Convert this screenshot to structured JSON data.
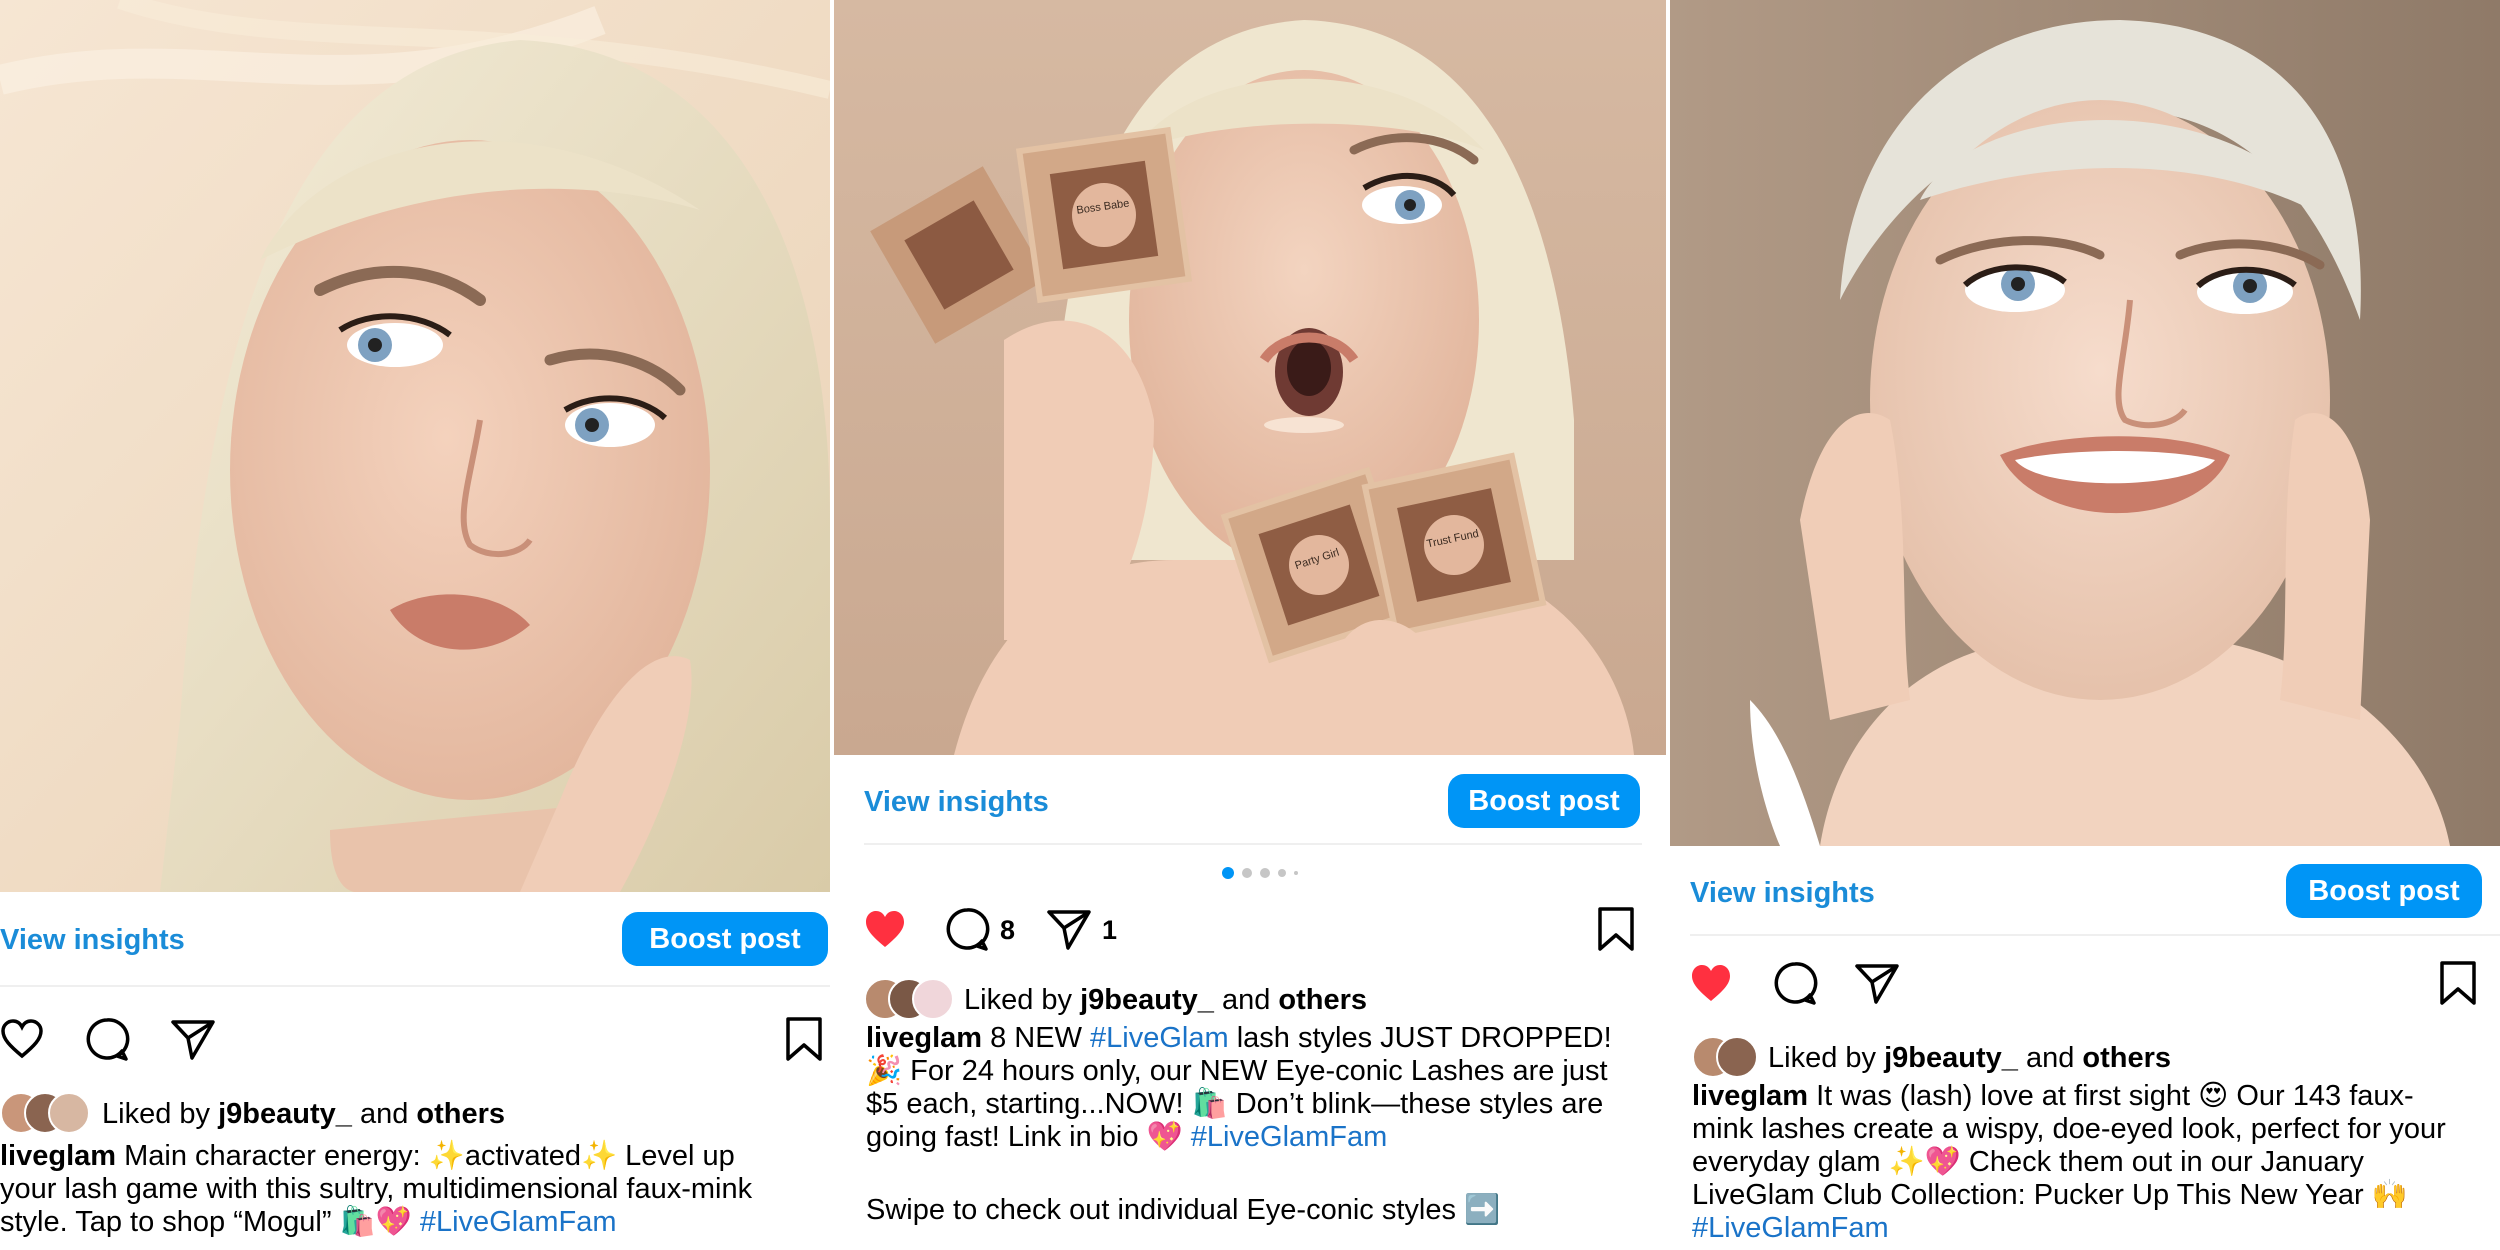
{
  "colors": {
    "accent": "#0095f6",
    "link": "#1a8cd8",
    "like_red": "#ff3040"
  },
  "posts": [
    {
      "view_insights": "View insights",
      "boost_post": "Boost post",
      "liked_prefix": "Liked by",
      "liked_user": "j9beauty_",
      "liked_and": "and",
      "liked_others": "others",
      "username": "liveglam",
      "caption_line1": "Main character energy: ✨activated✨ Level up",
      "caption_line2": "your lash game with this sultry, multidimensional faux-mink",
      "caption_line3": "style. Tap to shop “Mogul” 🛍️💖",
      "hashtag": "#LiveGlamFam",
      "liked": false
    },
    {
      "view_insights": "View insights",
      "boost_post": "Boost post",
      "comment_count": "8",
      "share_count": "1",
      "liked_prefix": "Liked by",
      "liked_user": "j9beauty_",
      "liked_and": "and",
      "liked_others": "others",
      "username": "liveglam",
      "caption_a": "8 NEW",
      "hashtag_inline": "#LiveGlam",
      "caption_b": "lash styles JUST DROPPED!",
      "caption_line2": "🎉 For 24 hours only, our NEW Eye-conic Lashes are just",
      "caption_line3": "$5 each, starting...NOW! 🛍️ Don’t blink—these styles are",
      "caption_line4": "going fast! Link in bio 💖",
      "hashtag": "#LiveGlamFam",
      "caption_line5": "Swipe to check out individual Eye-conic styles ➡️",
      "carousel_dots": 5,
      "carousel_active": 0,
      "liked": true,
      "lash_labels": [
        "Boss Babe",
        "Party Girl",
        "Trust Fund"
      ]
    },
    {
      "view_insights": "View insights",
      "boost_post": "Boost post",
      "liked_prefix": "Liked by",
      "liked_user": "j9beauty_",
      "liked_and": "and",
      "liked_others": "others",
      "username": "liveglam",
      "caption_line1": "It was (lash) love at first sight 😍 Our 143 faux-",
      "caption_line2": "mink lashes create a wispy, doe-eyed look, perfect for your",
      "caption_line3": "everyday glam ✨💖 Check them out in our January",
      "caption_line4": "LiveGlam Club Collection: Pucker Up This New Year 🙌",
      "hashtag": "#LiveGlamFam",
      "liked": true
    }
  ]
}
